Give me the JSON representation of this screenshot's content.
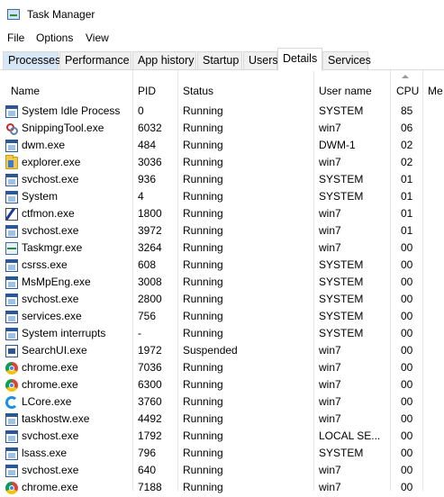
{
  "window": {
    "title": "Task Manager"
  },
  "menu": [
    "File",
    "Options",
    "View"
  ],
  "tabs": [
    "Processes",
    "Performance",
    "App history",
    "Startup",
    "Users",
    "Details",
    "Services"
  ],
  "active_tab": "Details",
  "columns": {
    "name": "Name",
    "pid": "PID",
    "status": "Status",
    "user": "User name",
    "cpu": "CPU",
    "mem": "Me"
  },
  "processes": [
    {
      "name": "System Idle Process",
      "pid": "0",
      "status": "Running",
      "user": "SYSTEM",
      "cpu": "85",
      "icon": "window-icon"
    },
    {
      "name": "SnippingTool.exe",
      "pid": "6032",
      "status": "Running",
      "user": "win7",
      "cpu": "06",
      "icon": "scissors-icon"
    },
    {
      "name": "dwm.exe",
      "pid": "484",
      "status": "Running",
      "user": "DWM-1",
      "cpu": "02",
      "icon": "window-icon"
    },
    {
      "name": "explorer.exe",
      "pid": "3036",
      "status": "Running",
      "user": "win7",
      "cpu": "02",
      "icon": "folder-icon"
    },
    {
      "name": "svchost.exe",
      "pid": "936",
      "status": "Running",
      "user": "SYSTEM",
      "cpu": "01",
      "icon": "window-icon"
    },
    {
      "name": "System",
      "pid": "4",
      "status": "Running",
      "user": "SYSTEM",
      "cpu": "01",
      "icon": "window-icon"
    },
    {
      "name": "ctfmon.exe",
      "pid": "1800",
      "status": "Running",
      "user": "win7",
      "cpu": "01",
      "icon": "pen-icon"
    },
    {
      "name": "svchost.exe",
      "pid": "3972",
      "status": "Running",
      "user": "win7",
      "cpu": "01",
      "icon": "window-icon"
    },
    {
      "name": "Taskmgr.exe",
      "pid": "3264",
      "status": "Running",
      "user": "win7",
      "cpu": "00",
      "icon": "monitor-icon"
    },
    {
      "name": "csrss.exe",
      "pid": "608",
      "status": "Running",
      "user": "SYSTEM",
      "cpu": "00",
      "icon": "window-icon"
    },
    {
      "name": "MsMpEng.exe",
      "pid": "3008",
      "status": "Running",
      "user": "SYSTEM",
      "cpu": "00",
      "icon": "window-icon"
    },
    {
      "name": "svchost.exe",
      "pid": "2800",
      "status": "Running",
      "user": "SYSTEM",
      "cpu": "00",
      "icon": "window-icon"
    },
    {
      "name": "services.exe",
      "pid": "756",
      "status": "Running",
      "user": "SYSTEM",
      "cpu": "00",
      "icon": "window-icon"
    },
    {
      "name": "System interrupts",
      "pid": "-",
      "status": "Running",
      "user": "SYSTEM",
      "cpu": "00",
      "icon": "window-icon"
    },
    {
      "name": "SearchUI.exe",
      "pid": "1972",
      "status": "Suspended",
      "user": "win7",
      "cpu": "00",
      "icon": "search-app-icon"
    },
    {
      "name": "chrome.exe",
      "pid": "7036",
      "status": "Running",
      "user": "win7",
      "cpu": "00",
      "icon": "chrome-icon"
    },
    {
      "name": "chrome.exe",
      "pid": "6300",
      "status": "Running",
      "user": "win7",
      "cpu": "00",
      "icon": "chrome-icon"
    },
    {
      "name": "LCore.exe",
      "pid": "3760",
      "status": "Running",
      "user": "win7",
      "cpu": "00",
      "icon": "lcore-icon"
    },
    {
      "name": "taskhostw.exe",
      "pid": "4492",
      "status": "Running",
      "user": "win7",
      "cpu": "00",
      "icon": "window-icon"
    },
    {
      "name": "svchost.exe",
      "pid": "1792",
      "status": "Running",
      "user": "LOCAL SE...",
      "cpu": "00",
      "icon": "window-icon"
    },
    {
      "name": "lsass.exe",
      "pid": "796",
      "status": "Running",
      "user": "SYSTEM",
      "cpu": "00",
      "icon": "window-icon"
    },
    {
      "name": "svchost.exe",
      "pid": "640",
      "status": "Running",
      "user": "win7",
      "cpu": "00",
      "icon": "window-icon"
    },
    {
      "name": "chrome.exe",
      "pid": "7188",
      "status": "Running",
      "user": "win7",
      "cpu": "00",
      "icon": "chrome-icon"
    }
  ]
}
